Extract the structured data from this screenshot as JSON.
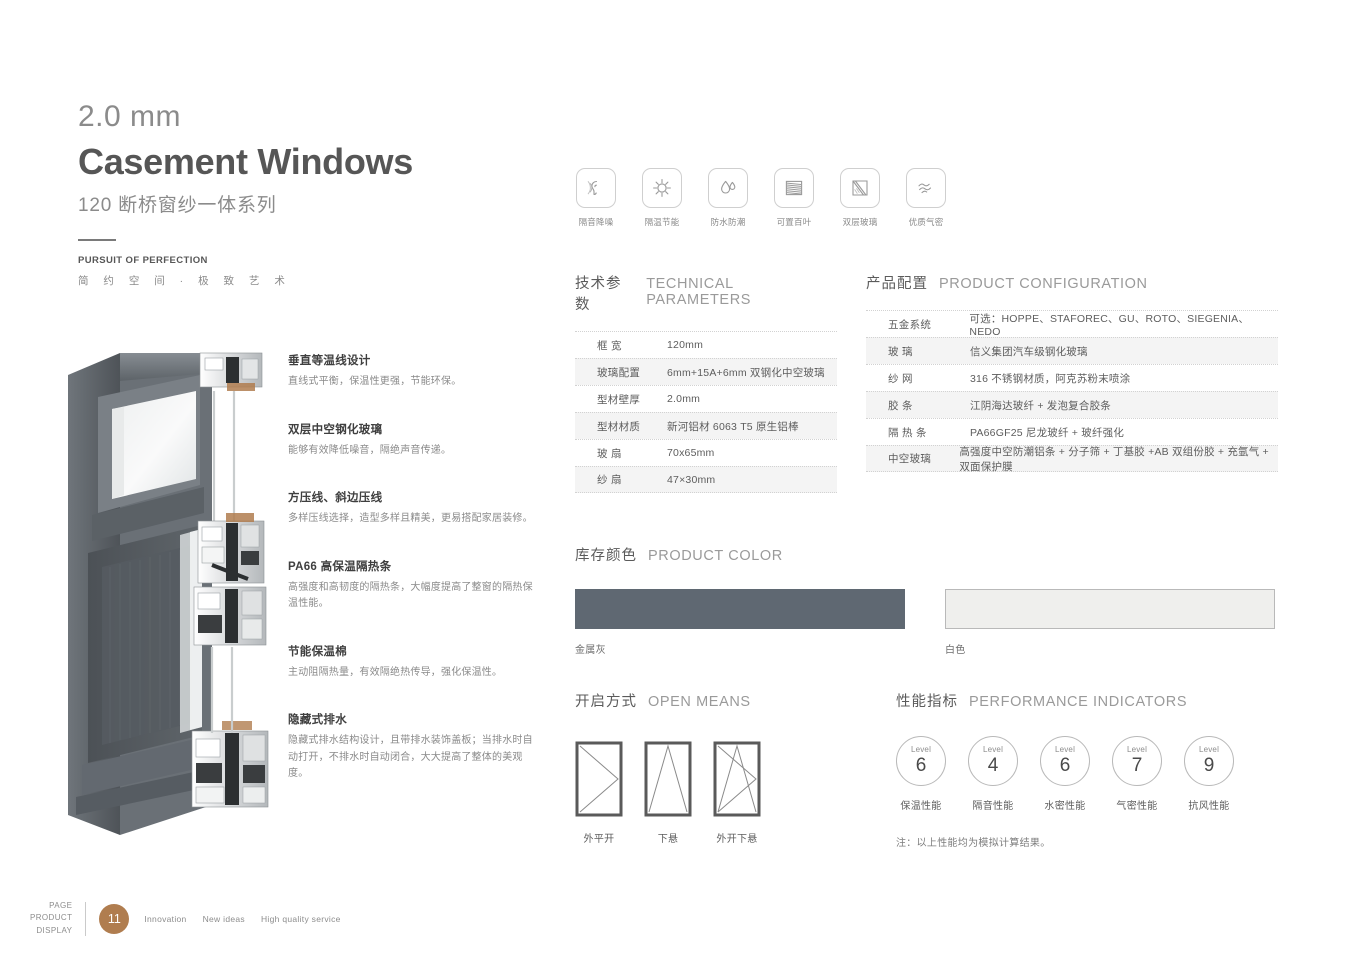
{
  "header": {
    "thickness": "2.0 mm",
    "title": "Casement Windows",
    "series": "120 断桥窗纱一体系列",
    "tagline_en": "PURSUIT OF PERFECTION",
    "tagline_cn": "简 约 空 间 · 极 致 艺 术"
  },
  "feature_icons": [
    {
      "icon": "ear-soundproof-icon",
      "label": "隔音降噪"
    },
    {
      "icon": "sun-thermal-icon",
      "label": "隔温节能"
    },
    {
      "icon": "water-drop-icon",
      "label": "防水防潮"
    },
    {
      "icon": "blinds-icon",
      "label": "可置百叶"
    },
    {
      "icon": "double-glass-icon",
      "label": "双层玻璃"
    },
    {
      "icon": "airtight-wave-icon",
      "label": "优质气密"
    }
  ],
  "technical_parameters": {
    "title_cn": "技术参数",
    "title_en": "TECHNICAL PARAMETERS",
    "rows": [
      {
        "key": "框    宽",
        "value": "120mm"
      },
      {
        "key": "玻璃配置",
        "value": "6mm+15A+6mm 双钢化中空玻璃"
      },
      {
        "key": "型材壁厚",
        "value": "2.0mm"
      },
      {
        "key": "型材材质",
        "value": "新河铝材  6063 T5 原生铝棒"
      },
      {
        "key": "玻    扇",
        "value": "70x65mm"
      },
      {
        "key": "纱    扇",
        "value": "47×30mm"
      }
    ]
  },
  "product_configuration": {
    "title_cn": "产品配置",
    "title_en": "PRODUCT CONFIGURATION",
    "rows": [
      {
        "key": "五金系统",
        "value": "可选：HOPPE、STAFOREC、GU、ROTO、SIEGENIA、NEDO"
      },
      {
        "key": "玻    璃",
        "value": "信义集团汽车级钢化玻璃"
      },
      {
        "key": "纱    网",
        "value": "316 不锈钢材质，阿克苏粉末喷涂"
      },
      {
        "key": "胶    条",
        "value": "江阴海达玻纤 + 发泡复合胶条"
      },
      {
        "key": "隔 热 条",
        "value": "PA66GF25 尼龙玻纤 + 玻纤强化"
      },
      {
        "key": "中空玻璃",
        "value": "高强度中空防潮铝条 + 分子筛 + 丁基胶 +AB 双组份胶 + 充氩气 + 双面保护膜"
      }
    ]
  },
  "features": [
    {
      "title": "垂直等温线设计",
      "desc": "直线式平衡，保温性更强，节能环保。"
    },
    {
      "title": "双层中空钢化玻璃",
      "desc": "能够有效降低噪音，隔绝声音传递。"
    },
    {
      "title": "方压线、斜边压线",
      "desc": "多样压线选择，造型多样且精美，更易搭配家居装修。"
    },
    {
      "title": "PA66 高保温隔热条",
      "desc": "高强度和高韧度的隔热条，大幅度提高了整窗的隔热保温性能。"
    },
    {
      "title": "节能保温棉",
      "desc": "主动阻隔热量，有效隔绝热传导，强化保温性。"
    },
    {
      "title": "隐藏式排水",
      "desc": "隐藏式排水结构设计，且带排水装饰盖板；当排水时自动打开，不排水时自动闭合，大大提高了整体的美观度。"
    }
  ],
  "product_color": {
    "title_cn": "库存颜色",
    "title_en": "PRODUCT COLOR",
    "swatches": [
      {
        "label": "金属灰",
        "color": "#5f6872"
      },
      {
        "label": "白色",
        "color": "#efefed"
      }
    ]
  },
  "open_means": {
    "title_cn": "开启方式",
    "title_en": "OPEN MEANS",
    "options": [
      {
        "label": "外平开",
        "diagram": "casement-outward-icon"
      },
      {
        "label": "下悬",
        "diagram": "bottom-hung-icon"
      },
      {
        "label": "外开下悬",
        "diagram": "outward-bottom-hung-icon"
      }
    ]
  },
  "performance": {
    "title_cn": "性能指标",
    "title_en": "PERFORMANCE INDICATORS",
    "level_word": "Level",
    "items": [
      {
        "level": "6",
        "label": "保温性能"
      },
      {
        "level": "4",
        "label": "隔音性能"
      },
      {
        "level": "6",
        "label": "水密性能"
      },
      {
        "level": "7",
        "label": "气密性能"
      },
      {
        "level": "9",
        "label": "抗风性能"
      }
    ],
    "note": "注：以上性能均为模拟计算结果。"
  },
  "footer": {
    "stack": [
      "PAGE",
      "PRODUCT",
      "DISPLAY"
    ],
    "page_number": "11",
    "page_badge_color": "#b07d4f",
    "tags": [
      "Innovation",
      "New ideas",
      "High quality service"
    ]
  }
}
